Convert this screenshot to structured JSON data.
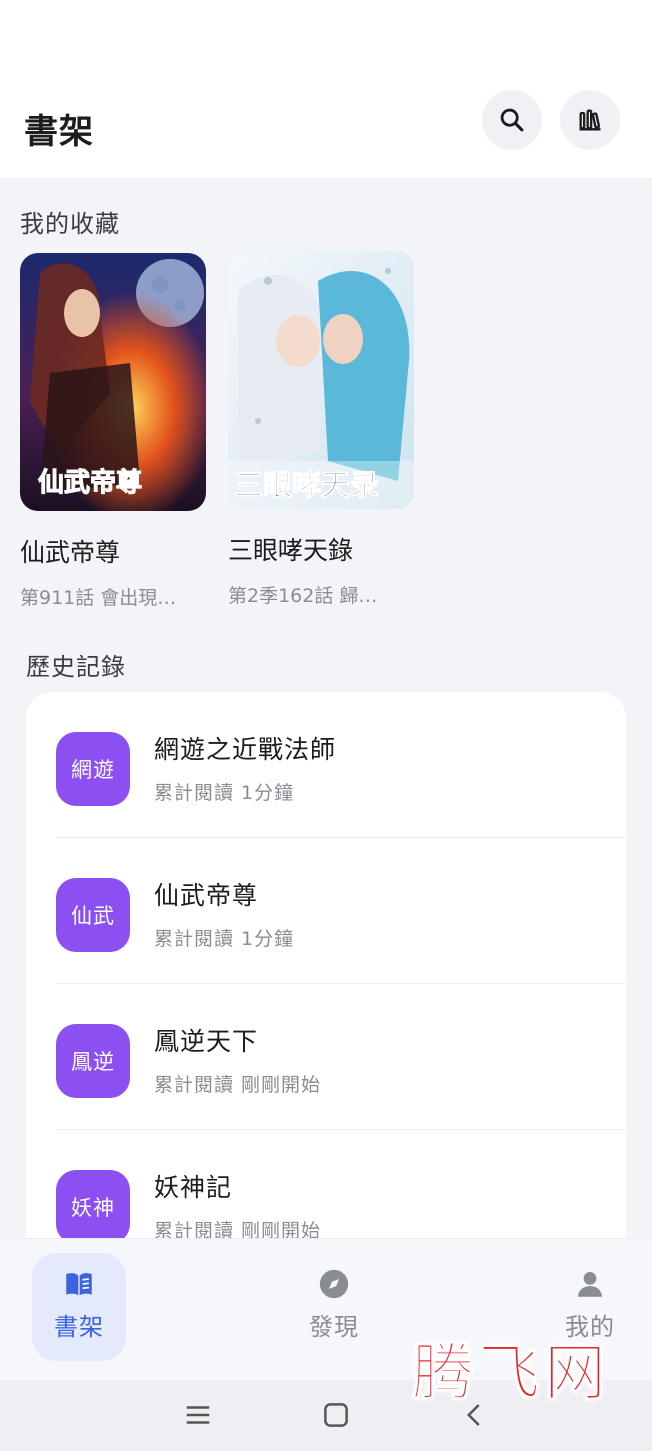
{
  "header": {
    "title": "書架",
    "search_icon": "search-icon",
    "library_icon": "bookshelf-icon"
  },
  "favorites": {
    "section_title": "我的收藏",
    "items": [
      {
        "title": "仙武帝尊",
        "subtitle": "第911話 會出現…",
        "cover_text": "仙武帝尊",
        "cover_colors": [
          "#1b2a6e",
          "#e2531b"
        ]
      },
      {
        "title": "三眼哮天錄",
        "subtitle": "第2季162話 歸…",
        "cover_text": "三眼哮天录",
        "cover_colors": [
          "#dfe9f2",
          "#5ab8d8"
        ]
      }
    ]
  },
  "history": {
    "section_title": "歷史記錄",
    "items": [
      {
        "badge": "網遊",
        "name": "網遊之近戰法師",
        "meta": "累計閱讀 1分鐘"
      },
      {
        "badge": "仙武",
        "name": "仙武帝尊",
        "meta": "累計閱讀 1分鐘"
      },
      {
        "badge": "鳳逆",
        "name": "鳳逆天下",
        "meta": "累計閱讀 剛剛開始"
      },
      {
        "badge": "妖神",
        "name": "妖神記",
        "meta": "累計閱讀 剛剛開始"
      }
    ]
  },
  "bottom_nav": {
    "items": [
      {
        "label": "書架",
        "icon": "book-icon",
        "active": true
      },
      {
        "label": "發現",
        "icon": "compass-icon",
        "active": false
      },
      {
        "label": "我的",
        "icon": "user-icon",
        "active": false
      }
    ]
  },
  "watermark": {
    "text": "腾飞网"
  },
  "colors": {
    "accent": "#3c63e0",
    "badge": "#8b4ff2",
    "background": "#f3f4f8",
    "watermark": "#e8232a"
  }
}
